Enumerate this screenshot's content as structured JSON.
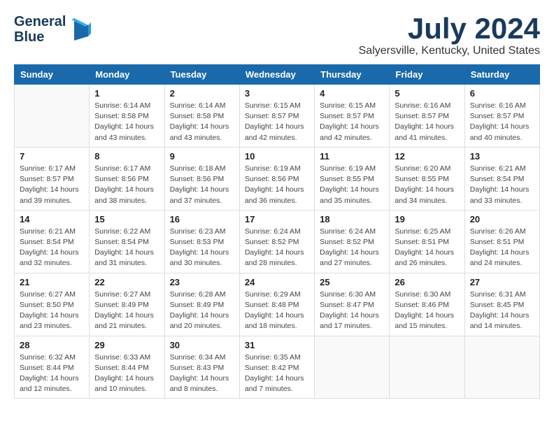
{
  "header": {
    "logo_line1": "General",
    "logo_line2": "Blue",
    "month_title": "July 2024",
    "location": "Salyersville, Kentucky, United States"
  },
  "days_of_week": [
    "Sunday",
    "Monday",
    "Tuesday",
    "Wednesday",
    "Thursday",
    "Friday",
    "Saturday"
  ],
  "weeks": [
    [
      {
        "day": "",
        "info": ""
      },
      {
        "day": "1",
        "info": "Sunrise: 6:14 AM\nSunset: 8:58 PM\nDaylight: 14 hours\nand 43 minutes."
      },
      {
        "day": "2",
        "info": "Sunrise: 6:14 AM\nSunset: 8:58 PM\nDaylight: 14 hours\nand 43 minutes."
      },
      {
        "day": "3",
        "info": "Sunrise: 6:15 AM\nSunset: 8:57 PM\nDaylight: 14 hours\nand 42 minutes."
      },
      {
        "day": "4",
        "info": "Sunrise: 6:15 AM\nSunset: 8:57 PM\nDaylight: 14 hours\nand 42 minutes."
      },
      {
        "day": "5",
        "info": "Sunrise: 6:16 AM\nSunset: 8:57 PM\nDaylight: 14 hours\nand 41 minutes."
      },
      {
        "day": "6",
        "info": "Sunrise: 6:16 AM\nSunset: 8:57 PM\nDaylight: 14 hours\nand 40 minutes."
      }
    ],
    [
      {
        "day": "7",
        "info": "Sunrise: 6:17 AM\nSunset: 8:57 PM\nDaylight: 14 hours\nand 39 minutes."
      },
      {
        "day": "8",
        "info": "Sunrise: 6:17 AM\nSunset: 8:56 PM\nDaylight: 14 hours\nand 38 minutes."
      },
      {
        "day": "9",
        "info": "Sunrise: 6:18 AM\nSunset: 8:56 PM\nDaylight: 14 hours\nand 37 minutes."
      },
      {
        "day": "10",
        "info": "Sunrise: 6:19 AM\nSunset: 8:56 PM\nDaylight: 14 hours\nand 36 minutes."
      },
      {
        "day": "11",
        "info": "Sunrise: 6:19 AM\nSunset: 8:55 PM\nDaylight: 14 hours\nand 35 minutes."
      },
      {
        "day": "12",
        "info": "Sunrise: 6:20 AM\nSunset: 8:55 PM\nDaylight: 14 hours\nand 34 minutes."
      },
      {
        "day": "13",
        "info": "Sunrise: 6:21 AM\nSunset: 8:54 PM\nDaylight: 14 hours\nand 33 minutes."
      }
    ],
    [
      {
        "day": "14",
        "info": "Sunrise: 6:21 AM\nSunset: 8:54 PM\nDaylight: 14 hours\nand 32 minutes."
      },
      {
        "day": "15",
        "info": "Sunrise: 6:22 AM\nSunset: 8:54 PM\nDaylight: 14 hours\nand 31 minutes."
      },
      {
        "day": "16",
        "info": "Sunrise: 6:23 AM\nSunset: 8:53 PM\nDaylight: 14 hours\nand 30 minutes."
      },
      {
        "day": "17",
        "info": "Sunrise: 6:24 AM\nSunset: 8:52 PM\nDaylight: 14 hours\nand 28 minutes."
      },
      {
        "day": "18",
        "info": "Sunrise: 6:24 AM\nSunset: 8:52 PM\nDaylight: 14 hours\nand 27 minutes."
      },
      {
        "day": "19",
        "info": "Sunrise: 6:25 AM\nSunset: 8:51 PM\nDaylight: 14 hours\nand 26 minutes."
      },
      {
        "day": "20",
        "info": "Sunrise: 6:26 AM\nSunset: 8:51 PM\nDaylight: 14 hours\nand 24 minutes."
      }
    ],
    [
      {
        "day": "21",
        "info": "Sunrise: 6:27 AM\nSunset: 8:50 PM\nDaylight: 14 hours\nand 23 minutes."
      },
      {
        "day": "22",
        "info": "Sunrise: 6:27 AM\nSunset: 8:49 PM\nDaylight: 14 hours\nand 21 minutes."
      },
      {
        "day": "23",
        "info": "Sunrise: 6:28 AM\nSunset: 8:49 PM\nDaylight: 14 hours\nand 20 minutes."
      },
      {
        "day": "24",
        "info": "Sunrise: 6:29 AM\nSunset: 8:48 PM\nDaylight: 14 hours\nand 18 minutes."
      },
      {
        "day": "25",
        "info": "Sunrise: 6:30 AM\nSunset: 8:47 PM\nDaylight: 14 hours\nand 17 minutes."
      },
      {
        "day": "26",
        "info": "Sunrise: 6:30 AM\nSunset: 8:46 PM\nDaylight: 14 hours\nand 15 minutes."
      },
      {
        "day": "27",
        "info": "Sunrise: 6:31 AM\nSunset: 8:45 PM\nDaylight: 14 hours\nand 14 minutes."
      }
    ],
    [
      {
        "day": "28",
        "info": "Sunrise: 6:32 AM\nSunset: 8:44 PM\nDaylight: 14 hours\nand 12 minutes."
      },
      {
        "day": "29",
        "info": "Sunrise: 6:33 AM\nSunset: 8:44 PM\nDaylight: 14 hours\nand 10 minutes."
      },
      {
        "day": "30",
        "info": "Sunrise: 6:34 AM\nSunset: 8:43 PM\nDaylight: 14 hours\nand 8 minutes."
      },
      {
        "day": "31",
        "info": "Sunrise: 6:35 AM\nSunset: 8:42 PM\nDaylight: 14 hours\nand 7 minutes."
      },
      {
        "day": "",
        "info": ""
      },
      {
        "day": "",
        "info": ""
      },
      {
        "day": "",
        "info": ""
      }
    ]
  ]
}
